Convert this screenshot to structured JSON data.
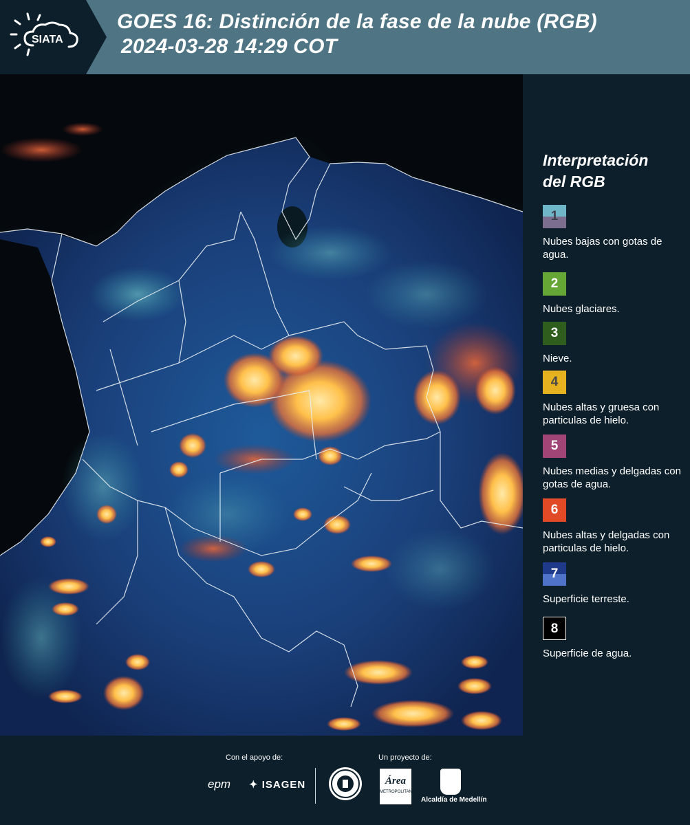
{
  "header": {
    "logo_text": "SIATA",
    "title_line1": "GOES 16: Distinción de la fase de la nube (RGB)",
    "title_line2": "2024-03-28 14:29 COT"
  },
  "legend": {
    "title_line1": "Interpretación",
    "title_line2": "del RGB",
    "items": [
      {
        "number": "1",
        "label": "Nubes bajas con gotas de agua.",
        "color_top": "#6fb7c8",
        "color_bottom": "#7b6e8e"
      },
      {
        "number": "2",
        "label": "Nubes glaciares.",
        "color_top": "#65a637",
        "color_bottom": "#65a637"
      },
      {
        "number": "3",
        "label": "Nieve.",
        "color_top": "#2f5d1e",
        "color_bottom": "#2f5d1e"
      },
      {
        "number": "4",
        "label": "Nubes altas y gruesa con particulas de hielo.",
        "color_top": "#e6b21f",
        "color_bottom": "#e6b21f"
      },
      {
        "number": "5",
        "label": "Nubes medias y delgadas con gotas de agua.",
        "color_top": "#a04575",
        "color_bottom": "#a04575"
      },
      {
        "number": "6",
        "label": "Nubes altas y delgadas con particulas de hielo.",
        "color_top": "#e04a26",
        "color_bottom": "#e04a26"
      },
      {
        "number": "7",
        "label": "Superficie terreste.",
        "color_top": "#1f3a8a",
        "color_bottom": "#4f73c9"
      },
      {
        "number": "8",
        "label": "Superficie de agua.",
        "color_top": "#000000",
        "color_bottom": "#000000"
      }
    ]
  },
  "footer": {
    "support_label": "Con el apoyo de:",
    "project_label": "Un proyecto de:",
    "sponsor1": "epm",
    "sponsor2": "ISAGEN",
    "partner_medellin": "Alcaldía de Medellín",
    "area_logo_text": "Área",
    "area_logo_subtext": "METROPOLITANA"
  }
}
